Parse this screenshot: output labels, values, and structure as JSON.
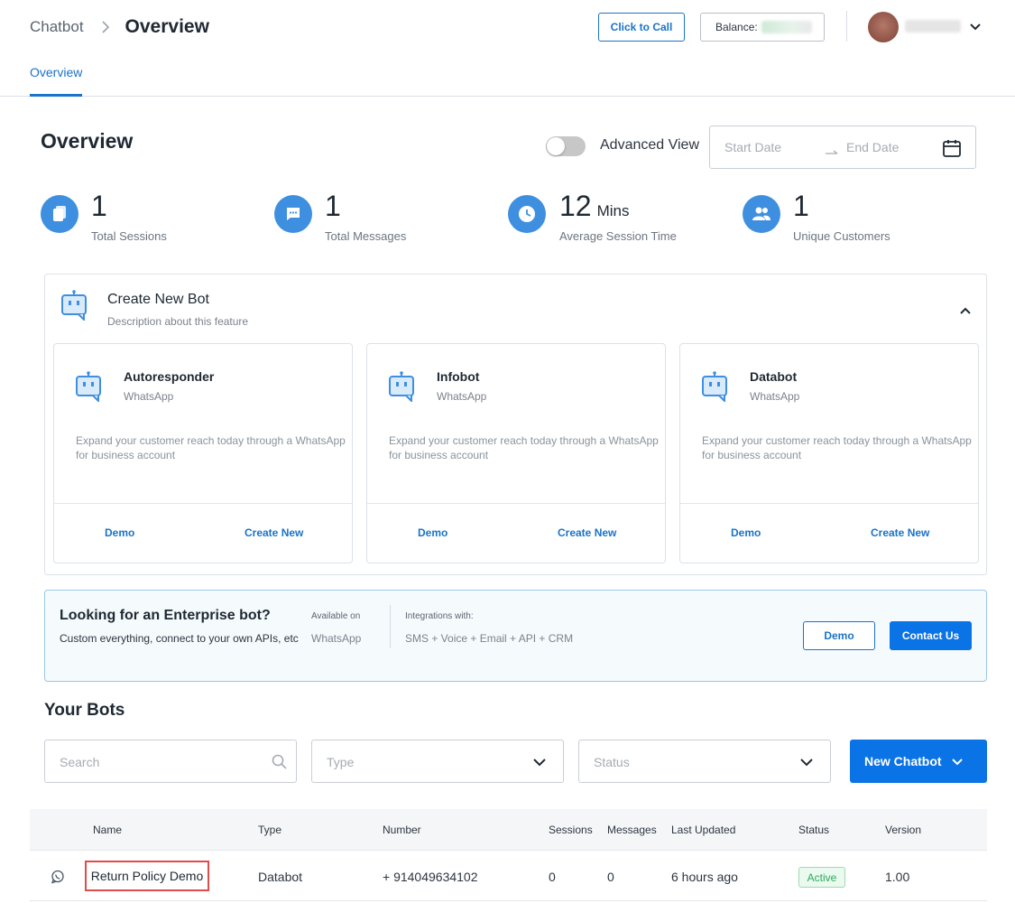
{
  "header": {
    "breadcrumb_root": "Chatbot",
    "breadcrumb_current": "Overview",
    "click_to_call_label": "Click to Call",
    "balance_label": "Balance:",
    "tab_overview": "Overview"
  },
  "overview": {
    "title": "Overview",
    "advanced_view_label": "Advanced View",
    "advanced_view_on": false,
    "start_date_placeholder": "Start Date",
    "end_date_placeholder": "End Date"
  },
  "stats": [
    {
      "icon": "file-icon",
      "value": "1",
      "unit": "",
      "label": "Total Sessions"
    },
    {
      "icon": "message-icon",
      "value": "1",
      "unit": "",
      "label": "Total Messages"
    },
    {
      "icon": "clock-icon",
      "value": "12",
      "unit": "Mins",
      "label": "Average Session Time"
    },
    {
      "icon": "users-icon",
      "value": "1",
      "unit": "",
      "label": "Unique Customers"
    }
  ],
  "create_panel": {
    "title": "Create New Bot",
    "description": "Description about this feature",
    "cards": [
      {
        "title": "Autoresponder",
        "channel": "WhatsApp",
        "description": "Expand your customer reach today through a WhatsApp for business account",
        "demo_label": "Demo",
        "create_label": "Create New"
      },
      {
        "title": "Infobot",
        "channel": "WhatsApp",
        "description": "Expand your customer reach today through a WhatsApp for business account",
        "demo_label": "Demo",
        "create_label": "Create New"
      },
      {
        "title": "Databot",
        "channel": "WhatsApp",
        "description": "Expand your customer reach today through a WhatsApp for business account",
        "demo_label": "Demo",
        "create_label": "Create New"
      }
    ]
  },
  "enterprise": {
    "title": "Looking for an Enterprise bot?",
    "description": "Custom everything, connect to your own APIs, etc",
    "available_label": "Available on",
    "available_value": "WhatsApp",
    "integrations_label": "Integrations with:",
    "integrations_value": "SMS + Voice + Email + API + CRM",
    "demo_label": "Demo",
    "contact_label": "Contact Us"
  },
  "bots": {
    "title": "Your Bots",
    "search_placeholder": "Search",
    "type_placeholder": "Type",
    "status_placeholder": "Status",
    "new_chatbot_label": "New Chatbot",
    "columns": [
      "Name",
      "Type",
      "Number",
      "Sessions",
      "Messages",
      "Last Updated",
      "Status",
      "Version"
    ],
    "rows": [
      {
        "name": "Return Policy Demo",
        "type": "Databot",
        "number": "+ 914049634102",
        "sessions": "0",
        "messages": "0",
        "last_updated": "6 hours ago",
        "status": "Active",
        "version": "1.00"
      }
    ]
  },
  "colors": {
    "accent": "#1a73c8",
    "primary_button": "#0a73e6",
    "stat_icon_bg": "#3f8fe0",
    "active_status": "#2ea85a",
    "highlight": "#e04b4b"
  }
}
